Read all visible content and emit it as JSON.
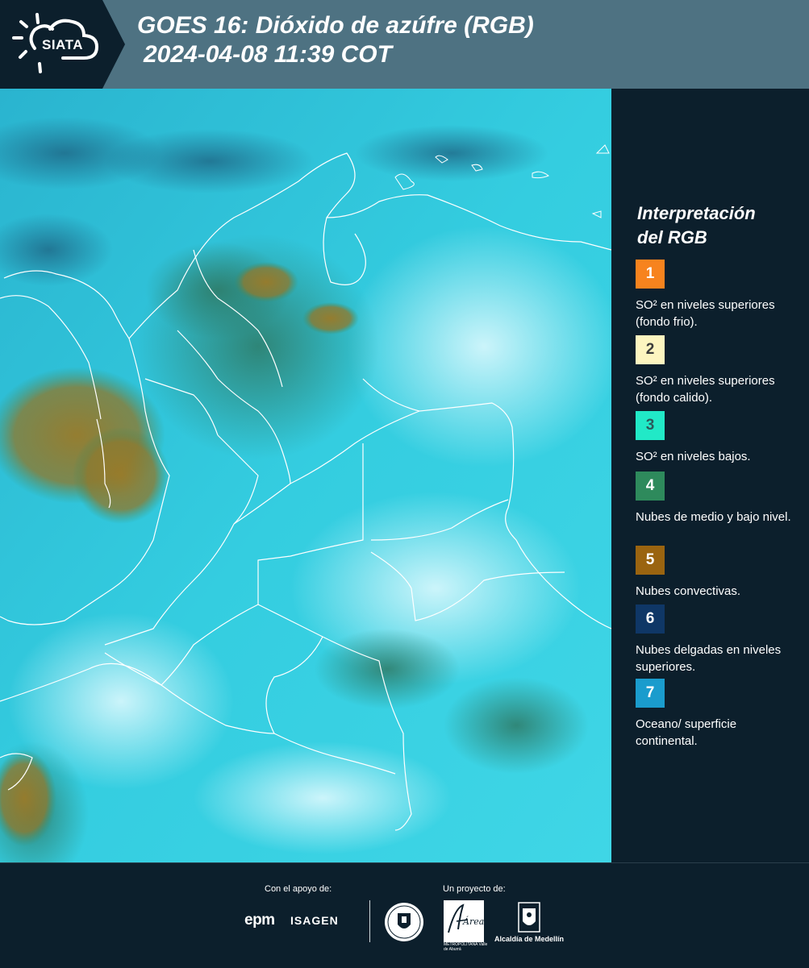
{
  "header": {
    "logo_text": "SIATA",
    "title_line1": "GOES 16: Dióxido de azúfre (RGB)",
    "title_line2": "2024-04-08 11:39 COT"
  },
  "legend": {
    "title_line1": "Interpretación",
    "title_line2": "del RGB",
    "items": [
      {
        "number": "1",
        "color": "#f7831e",
        "text_color": "#ffffff",
        "label": "SO² en niveles superiores (fondo frio)."
      },
      {
        "number": "2",
        "color": "#fdf5c0",
        "text_color": "#3b3b3b",
        "label": "SO² en niveles superiores (fondo calido)."
      },
      {
        "number": "3",
        "color": "#21e9c7",
        "text_color": "#2b5b5b",
        "label": "SO² en niveles bajos."
      },
      {
        "number": "4",
        "color": "#2e8a5c",
        "text_color": "#ffffff",
        "label": "Nubes de medio y bajo nivel."
      },
      {
        "number": "5",
        "color": "#9a6410",
        "text_color": "#ffffff",
        "label": "Nubes convectivas."
      },
      {
        "number": "6",
        "color": "#0f3766",
        "text_color": "#ffffff",
        "label": "Nubes delgadas en niveles superiores."
      },
      {
        "number": "7",
        "color": "#1a9ccd",
        "text_color": "#ffffff",
        "label": "Oceano/ superficie continental."
      }
    ]
  },
  "footer": {
    "support_label": "Con el apoyo de:",
    "project_label": "Un proyecto de:",
    "epm": "epm",
    "isagen": "ISAGEN",
    "alcaldia": "Alcaldía de Medellín",
    "area_name": "Área",
    "area_subtitle": "METROPOLITANA Valle de Aburrá"
  }
}
